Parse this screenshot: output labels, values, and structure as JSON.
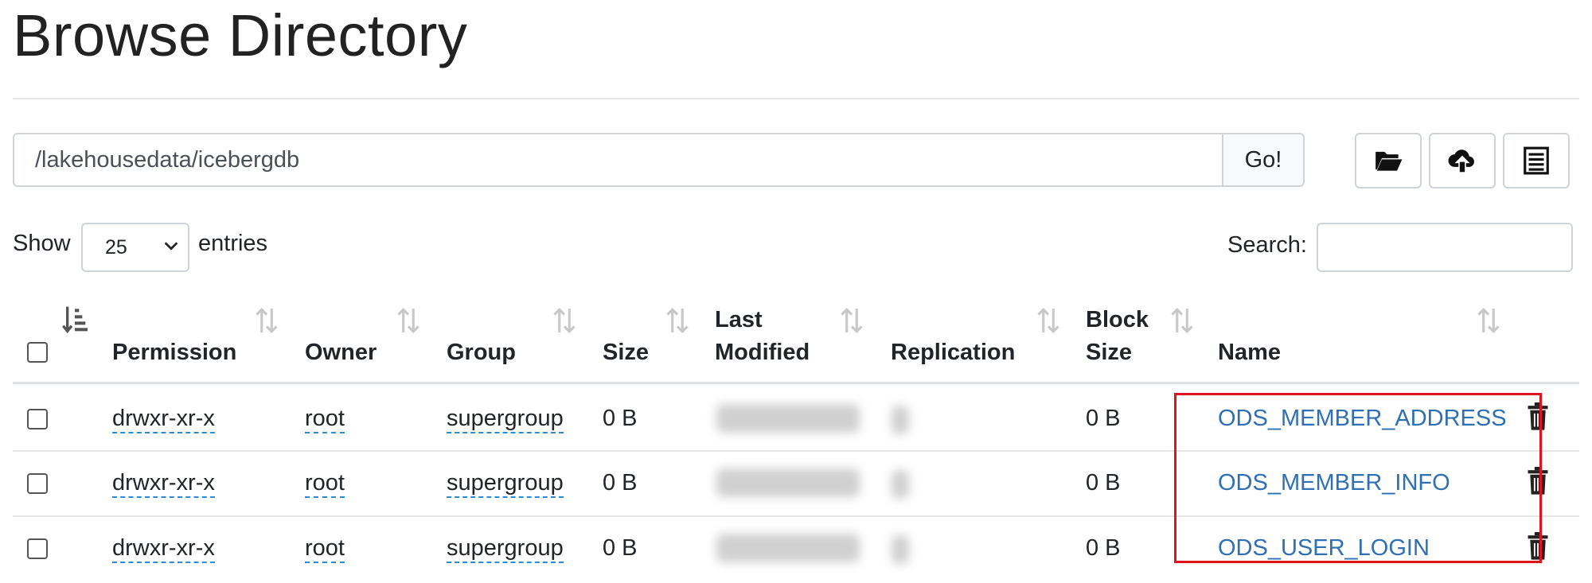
{
  "page": {
    "title": "Browse Directory"
  },
  "pathbar": {
    "path": "/lakehousedata/icebergdb",
    "go_label": "Go!"
  },
  "toolbar": {
    "create_folder_icon": "folder-open-icon",
    "upload_icon": "cloud-upload-icon",
    "list_icon": "list-icon"
  },
  "controls": {
    "show_label": "Show",
    "entries_value": "25",
    "entries_label": "entries",
    "search_label": "Search:",
    "search_value": ""
  },
  "table": {
    "headers": {
      "permission": "Permission",
      "owner": "Owner",
      "group": "Group",
      "size": "Size",
      "last_modified_1": "Last",
      "last_modified_2": "Modified",
      "replication": "Replication",
      "block_size_1": "Block",
      "block_size_2": "Size",
      "name": "Name"
    },
    "rows": [
      {
        "permission": "drwxr-xr-x",
        "owner": "root",
        "group": "supergroup",
        "size": "0 B",
        "block_size": "0 B",
        "name": "ODS_MEMBER_ADDRESS"
      },
      {
        "permission": "drwxr-xr-x",
        "owner": "root",
        "group": "supergroup",
        "size": "0 B",
        "block_size": "0 B",
        "name": "ODS_MEMBER_INFO"
      },
      {
        "permission": "drwxr-xr-x",
        "owner": "root",
        "group": "supergroup",
        "size": "0 B",
        "block_size": "0 B",
        "name": "ODS_USER_LOGIN"
      }
    ]
  },
  "colors": {
    "link": "#2f6fb3",
    "highlight": "#e0141f",
    "border": "#ced4da"
  }
}
